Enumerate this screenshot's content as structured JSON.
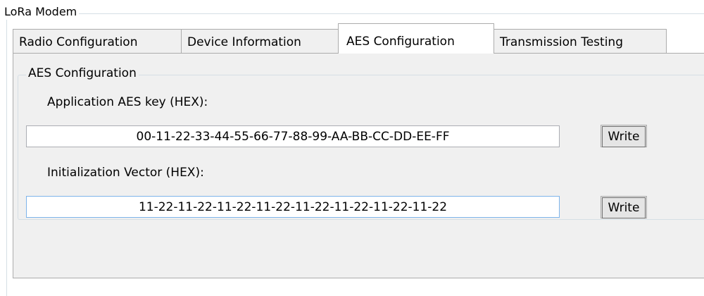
{
  "groupbox": {
    "title": "LoRa Modem"
  },
  "tabs": [
    {
      "label": "Radio Configuration",
      "active": false
    },
    {
      "label": "Device Information",
      "active": false
    },
    {
      "label": "AES Configuration",
      "active": true
    },
    {
      "label": "Transmission Testing",
      "active": false
    }
  ],
  "aes": {
    "group_title": "AES Configuration",
    "key_label": "Application AES key (HEX):",
    "key_value": "00-11-22-33-44-55-66-77-88-99-AA-BB-CC-DD-EE-FF",
    "iv_label": "Initialization Vector (HEX):",
    "iv_value": "11-22-11-22-11-22-11-22-11-22-11-22-11-22-11-22",
    "write_label": "Write"
  }
}
